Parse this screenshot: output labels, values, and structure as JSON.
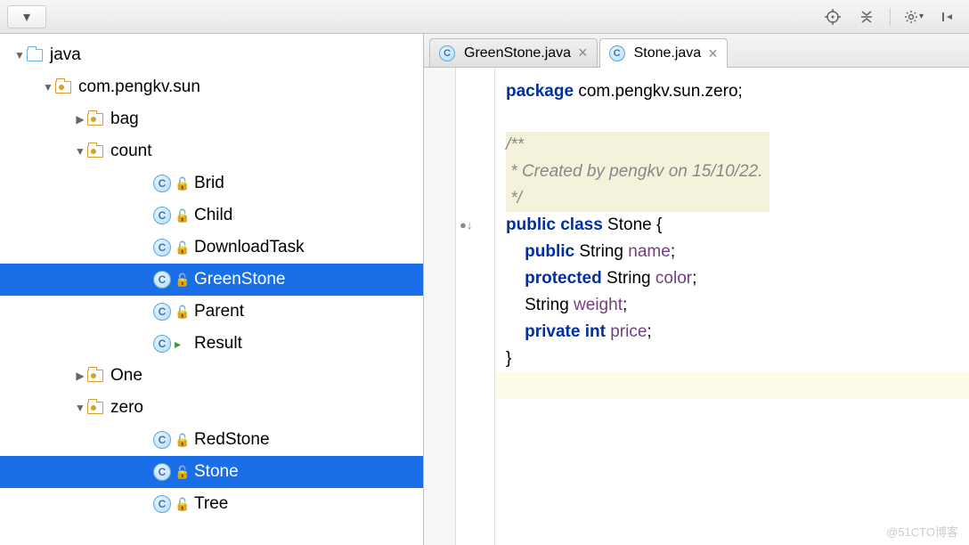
{
  "toolbar": {
    "dropdown": "▾"
  },
  "tabs": [
    {
      "label": "GreenStone.java",
      "active": false
    },
    {
      "label": "Stone.java",
      "active": true
    }
  ],
  "tree": {
    "root": {
      "label": "java"
    },
    "pkg": {
      "label": "com.pengkv.sun"
    },
    "bag": {
      "label": "bag"
    },
    "count": {
      "label": "count"
    },
    "count_items": {
      "brid": "Brid",
      "child": "Child",
      "download": "DownloadTask",
      "green": "GreenStone",
      "parent": "Parent",
      "result": "Result"
    },
    "one": {
      "label": "One"
    },
    "zero": {
      "label": "zero"
    },
    "zero_items": {
      "red": "RedStone",
      "stone": "Stone",
      "tree": "Tree"
    }
  },
  "code": {
    "package_kw": "package",
    "package_name": " com.pengkv.sun.zero;",
    "doc1": "/**",
    "doc2": " * Created by pengkv on 15/10/22.",
    "doc3": " */",
    "public": "public",
    "class": "class",
    "classname": " Stone {",
    "protected": "protected",
    "private": "private",
    "string": " String ",
    "int": "int",
    "name": "name",
    "color": "color",
    "weight": "weight",
    "price": "price",
    "semi": ";",
    "string_plain": "String ",
    "close": "}"
  },
  "watermark": "@51CTO博客"
}
